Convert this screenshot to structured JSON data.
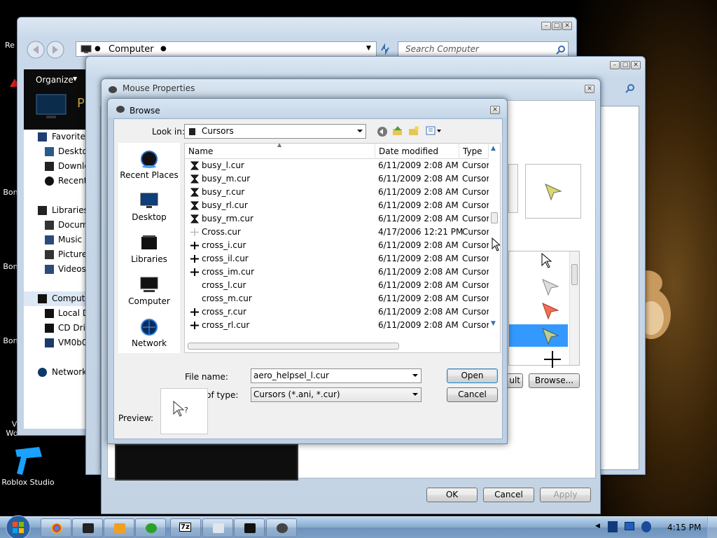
{
  "desktop": {
    "icons": [
      {
        "label": "Re",
        "name": "desktop-icon-recycle"
      },
      {
        "label": "Bon",
        "name": "desktop-icon-bonzi-1"
      },
      {
        "label": "Bon",
        "name": "desktop-icon-bonzi-2"
      },
      {
        "label": "Bon",
        "name": "desktop-icon-bonzi-3"
      },
      {
        "label": "V\nWo",
        "name": "desktop-icon-vwo"
      },
      {
        "label": "Roblox Studio",
        "name": "desktop-icon-roblox-studio"
      }
    ]
  },
  "explorer": {
    "address": "Computer",
    "search_placeholder": "Search Computer",
    "organize_label": "Organize",
    "nav": [
      {
        "label": "Favorites",
        "icon": "star-icon",
        "indent": 0
      },
      {
        "label": "Desktop",
        "icon": "desktop-icon",
        "indent": 1
      },
      {
        "label": "Downloads",
        "icon": "downloads-icon",
        "indent": 1
      },
      {
        "label": "Recent Places",
        "icon": "recent-icon",
        "indent": 1
      },
      {
        "label": "",
        "icon": "",
        "indent": 0
      },
      {
        "label": "Libraries",
        "icon": "libraries-icon",
        "indent": 0
      },
      {
        "label": "Documents",
        "icon": "documents-icon",
        "indent": 1
      },
      {
        "label": "Music",
        "icon": "music-icon",
        "indent": 1
      },
      {
        "label": "Pictures",
        "icon": "pictures-icon",
        "indent": 1
      },
      {
        "label": "Videos",
        "icon": "videos-icon",
        "indent": 1
      },
      {
        "label": "",
        "icon": "",
        "indent": 0
      },
      {
        "label": "Computer",
        "icon": "computer-icon",
        "indent": 0
      },
      {
        "label": "Local Disk",
        "icon": "disk-icon",
        "indent": 1
      },
      {
        "label": "CD Drive",
        "icon": "cd-icon",
        "indent": 1
      },
      {
        "label": "VM0b0",
        "icon": "vm-icon",
        "indent": 1
      },
      {
        "label": "",
        "icon": "",
        "indent": 0
      },
      {
        "label": "Network",
        "icon": "network-icon",
        "indent": 0
      }
    ]
  },
  "mouse_properties": {
    "title": "Mouse Properties",
    "browse_label": "Browse...",
    "use_default_fragment": "ult",
    "ok_label": "OK",
    "cancel_label": "Cancel",
    "apply_label": "Apply"
  },
  "browse": {
    "title": "Browse",
    "look_in_label": "Look in:",
    "look_in_value": "Cursors",
    "places": [
      "Recent Places",
      "Desktop",
      "Libraries",
      "Computer",
      "Network"
    ],
    "columns": [
      "Name",
      "Date modified",
      "Type"
    ],
    "files": [
      {
        "name": "busy_l.cur",
        "date": "6/11/2009 2:08 AM",
        "type": "Cursor",
        "icon": "hourglass"
      },
      {
        "name": "busy_m.cur",
        "date": "6/11/2009 2:08 AM",
        "type": "Cursor",
        "icon": "hourglass"
      },
      {
        "name": "busy_r.cur",
        "date": "6/11/2009 2:08 AM",
        "type": "Cursor",
        "icon": "hourglass"
      },
      {
        "name": "busy_rl.cur",
        "date": "6/11/2009 2:08 AM",
        "type": "Cursor",
        "icon": "hourglass"
      },
      {
        "name": "busy_rm.cur",
        "date": "6/11/2009 2:08 AM",
        "type": "Cursor",
        "icon": "hourglass"
      },
      {
        "name": "Cross.cur",
        "date": "4/17/2006 12:21 PM",
        "type": "Cursor",
        "icon": "cross-light"
      },
      {
        "name": "cross_i.cur",
        "date": "6/11/2009 2:08 AM",
        "type": "Cursor",
        "icon": "cross"
      },
      {
        "name": "cross_il.cur",
        "date": "6/11/2009 2:08 AM",
        "type": "Cursor",
        "icon": "cross"
      },
      {
        "name": "cross_im.cur",
        "date": "6/11/2009 2:08 AM",
        "type": "Cursor",
        "icon": "cross"
      },
      {
        "name": "cross_l.cur",
        "date": "6/11/2009 2:08 AM",
        "type": "Cursor",
        "icon": "none"
      },
      {
        "name": "cross_m.cur",
        "date": "6/11/2009 2:08 AM",
        "type": "Cursor",
        "icon": "none"
      },
      {
        "name": "cross_r.cur",
        "date": "6/11/2009 2:08 AM",
        "type": "Cursor",
        "icon": "cross"
      },
      {
        "name": "cross_rl.cur",
        "date": "6/11/2009 2:08 AM",
        "type": "Cursor",
        "icon": "cross"
      }
    ],
    "file_name_label": "File name:",
    "file_name_value": "aero_helpsel_l.cur",
    "file_type_label": "Files of type:",
    "file_type_value": "Cursors (*.ani, *.cur)",
    "open_label": "Open",
    "cancel_label": "Cancel",
    "preview_label": "Preview:"
  },
  "taskbar": {
    "clock": "4:15 PM",
    "items": [
      "chrome-icon",
      "terminal-icon",
      "media-player-icon",
      "network-app-icon",
      "7zip-icon",
      "explorer-folder-icon",
      "computer-window-icon",
      "mouse-properties-icon"
    ],
    "sevenzip_label": "7z"
  },
  "colors": {
    "selection": "#3399ff",
    "window_border": "#6f8aa8",
    "bonzi_purple": "#7b4fc9"
  }
}
